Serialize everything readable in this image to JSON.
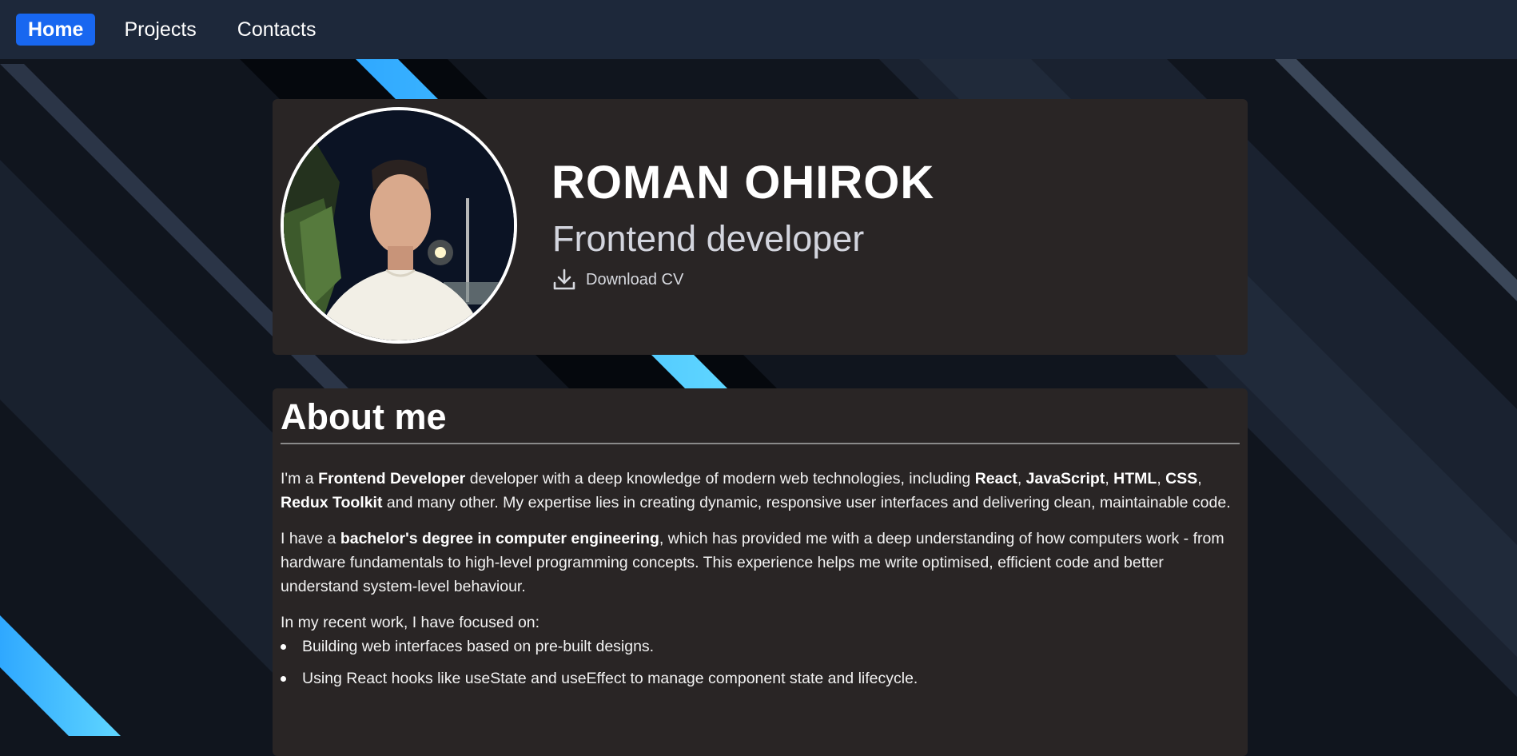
{
  "nav": {
    "home_label": "Home",
    "projects_label": "Projects",
    "contacts_label": "Contacts",
    "active": "Home"
  },
  "hero": {
    "name": "ROMAN OHIROK",
    "role": "Frontend developer",
    "download_label": "Download CV",
    "download_icon": "download-icon",
    "avatar": "profile-photo"
  },
  "about": {
    "title": "About me",
    "p1": {
      "s1": "I'm a ",
      "b1": "Frontend Developer",
      "s2": " developer with a deep knowledge of modern web technologies, including ",
      "b2": "React",
      "s3": ", ",
      "b3": "JavaScript",
      "s4": ", ",
      "b4": "HTML",
      "s5": ", ",
      "b5": "CSS",
      "s6": ", ",
      "b6": "Redux Toolkit",
      "s7": " and many other. My expertise lies in creating dynamic, responsive user interfaces and delivering clean, maintainable code."
    },
    "p2": {
      "s1": "I have a ",
      "b1": "bachelor's degree in computer engineering",
      "s2": ", which has provided me with a deep understanding of how computers work - from hardware fundamentals to high-level programming concepts. This experience helps me write optimised, efficient code and better understand system-level behaviour."
    },
    "focus_intro": "In my recent work, I have focused on:",
    "focus_items": [
      "Building web interfaces based on pre-built designs.",
      "Using React hooks like useState and useEffect to manage component state and lifecycle."
    ]
  },
  "colors": {
    "nav_bg": "#1d283a",
    "nav_active": "#1867f0",
    "card_bg": "#292525",
    "accent_stripe": "#3fb8ff",
    "page_bg": "#10151e"
  }
}
